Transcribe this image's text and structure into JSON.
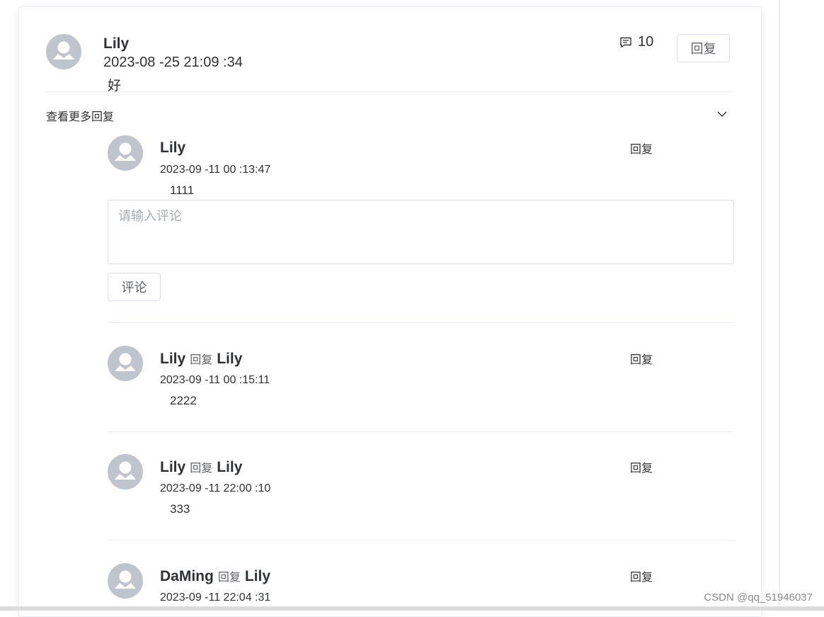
{
  "comment": {
    "author": "Lily",
    "time": "2023-08 -25 21:09 :34",
    "content": "好",
    "comment_count": "10",
    "reply_button": "回复"
  },
  "collapse": {
    "title": "查看更多回复"
  },
  "replies": [
    {
      "author": "Lily",
      "time": "2023-09 -11 00 :13:47",
      "content": "1111",
      "reply_label": "回复"
    },
    {
      "author": "Lily",
      "reply_word": "回复",
      "target": "Lily",
      "time": "2023-09 -11 00 :15:11",
      "content": "2222",
      "reply_label": "回复"
    },
    {
      "author": "Lily",
      "reply_word": "回复",
      "target": "Lily",
      "time": "2023-09 -11 22:00 :10",
      "content": "333",
      "reply_label": "回复"
    },
    {
      "author": "DaMing",
      "reply_word": "回复",
      "target": "Lily",
      "time": "2023-09 -11 22:04 :31",
      "content": "",
      "reply_label": "回复"
    }
  ],
  "reply_form": {
    "placeholder": "请输入评论",
    "value": "",
    "submit_label": "评论"
  },
  "watermark": "CSDN @qq_51946037",
  "icons": {
    "comment": "message-square-icon",
    "avatar": "user-avatar-icon",
    "chevron": "chevron-down-icon"
  }
}
